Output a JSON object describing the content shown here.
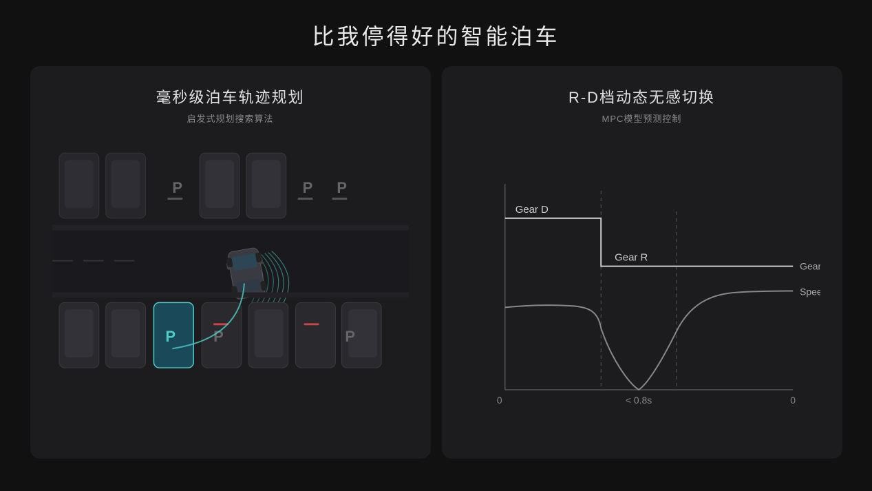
{
  "page": {
    "title": "比我停得好的智能泊车",
    "background": "#111111"
  },
  "left_panel": {
    "title": "毫秒级泊车轨迹规划",
    "subtitle": "启发式规划搜索算法"
  },
  "right_panel": {
    "title": "R-D档动态无感切换",
    "subtitle": "MPC模型预测控制",
    "chart": {
      "gear_d_label": "Gear D",
      "gear_r_label": "Gear R",
      "gear_label": "Gear",
      "speed_label": "Speed",
      "x_left": "0",
      "x_mid": "< 0.8s",
      "x_right": "0"
    }
  }
}
